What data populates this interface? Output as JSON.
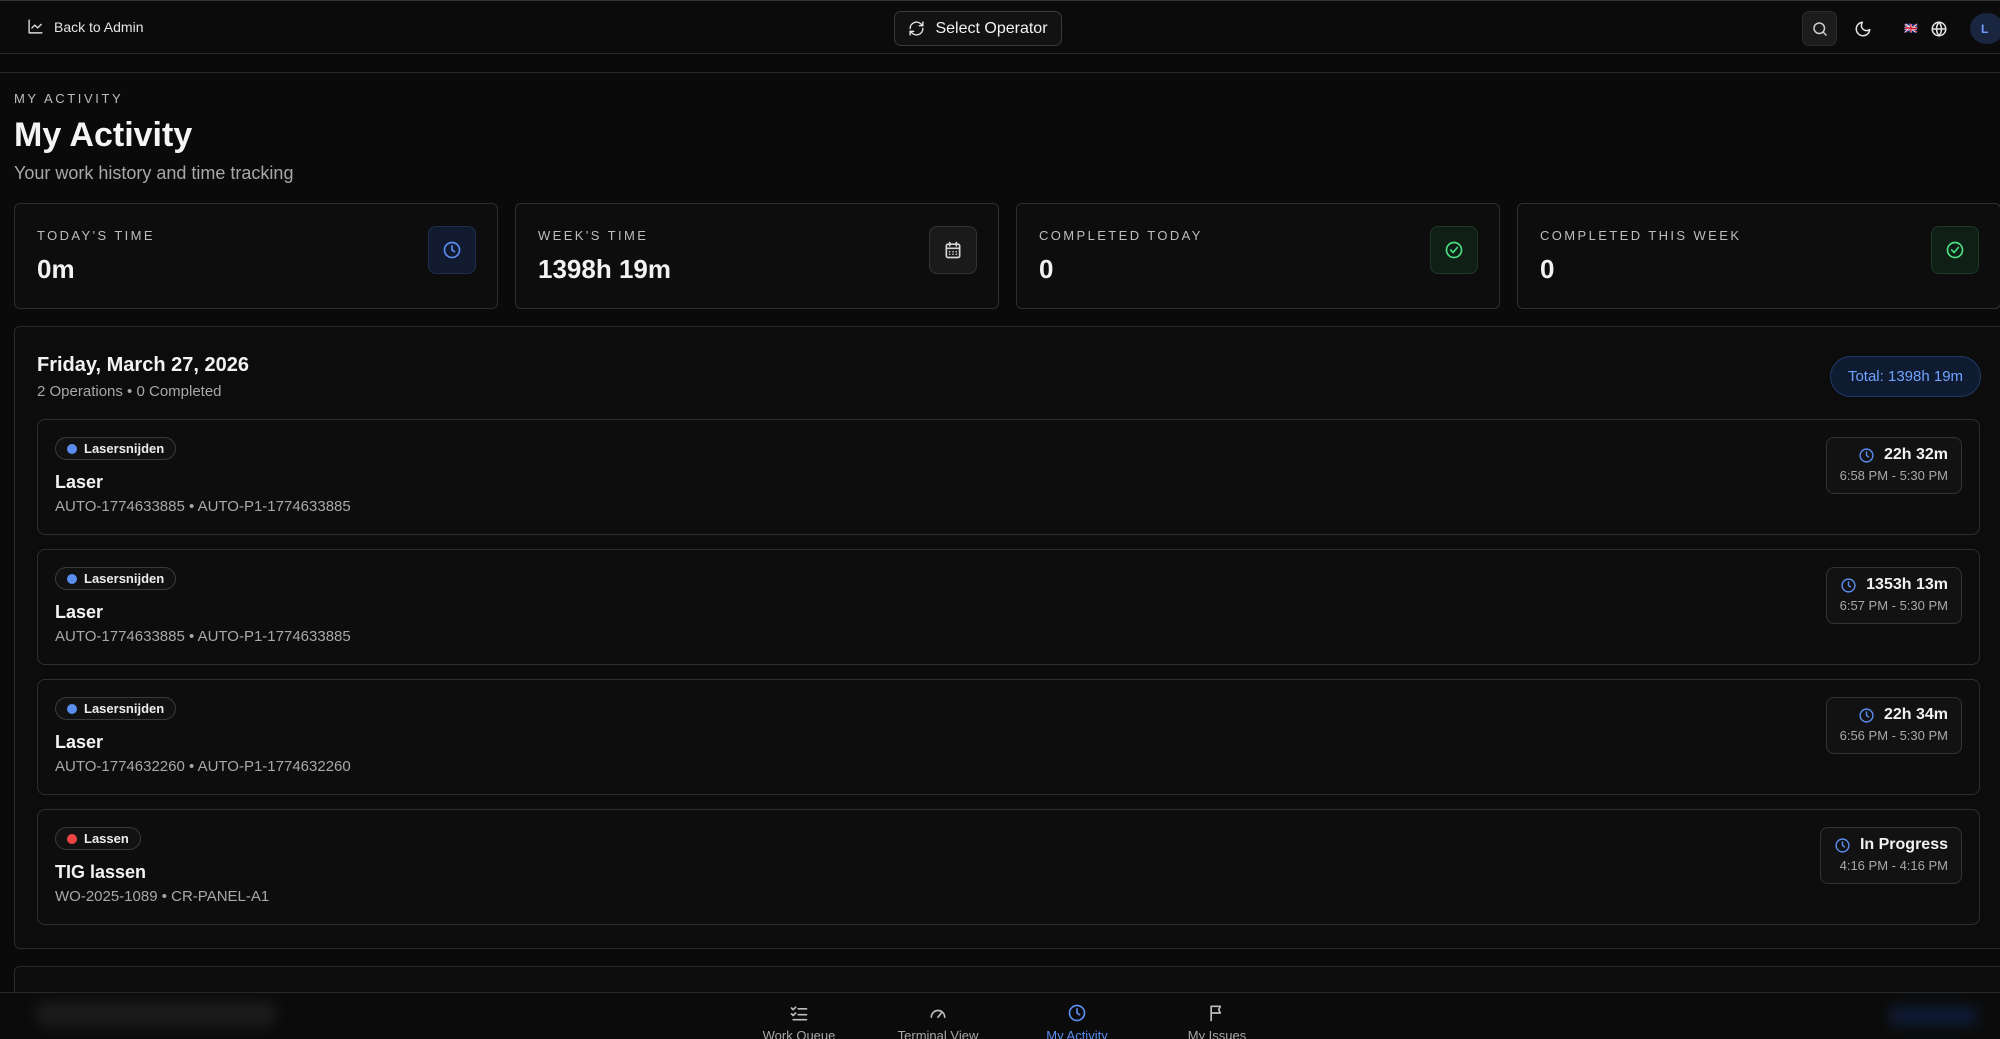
{
  "topbar": {
    "back_label": "Back to Admin",
    "select_operator_label": "Select Operator",
    "flag": "🇬🇧",
    "avatar_initial": "L"
  },
  "header": {
    "eyebrow": "MY ACTIVITY",
    "title": "My Activity",
    "subtitle": "Your work history and time tracking"
  },
  "stats": [
    {
      "label": "TODAY'S TIME",
      "value": "0m",
      "icon": "clock-icon",
      "accent": "#5b8def"
    },
    {
      "label": "WEEK'S TIME",
      "value": "1398h 19m",
      "icon": "calendar-icon",
      "accent": "#d4d4d4"
    },
    {
      "label": "COMPLETED TODAY",
      "value": "0",
      "icon": "check-circle-icon",
      "accent": "#4ade80"
    },
    {
      "label": "COMPLETED THIS WEEK",
      "value": "0",
      "icon": "check-circle-icon",
      "accent": "#4ade80"
    }
  ],
  "day": {
    "title": "Friday, March 27, 2026",
    "summary": "2 Operations • 0 Completed",
    "total": "Total: 1398h 19m",
    "operations": [
      {
        "category": "Lasersnijden",
        "category_color": "#5b8def",
        "name": "Laser",
        "refs": "AUTO-1774633885 • AUTO-P1-1774633885",
        "duration": "22h 32m",
        "range": "6:58 PM - 5:30 PM"
      },
      {
        "category": "Lasersnijden",
        "category_color": "#5b8def",
        "name": "Laser",
        "refs": "AUTO-1774633885 • AUTO-P1-1774633885",
        "duration": "1353h 13m",
        "range": "6:57 PM - 5:30 PM"
      },
      {
        "category": "Lasersnijden",
        "category_color": "#5b8def",
        "name": "Laser",
        "refs": "AUTO-1774632260 • AUTO-P1-1774632260",
        "duration": "22h 34m",
        "range": "6:56 PM - 5:30 PM"
      },
      {
        "category": "Lassen",
        "category_color": "#ef4444",
        "name": "TIG lassen",
        "refs": "WO-2025-1089 • CR-PANEL-A1",
        "duration": "In Progress",
        "range": "4:16 PM - 4:16 PM"
      }
    ]
  },
  "bottom_nav": {
    "items": [
      {
        "label": "Work Queue",
        "icon": "list-check-icon"
      },
      {
        "label": "Terminal View",
        "icon": "gauge-icon"
      },
      {
        "label": "My Activity",
        "icon": "clock-icon",
        "active": true
      },
      {
        "label": "My Issues",
        "icon": "flag-icon"
      }
    ],
    "active_color": "#5b8def"
  }
}
